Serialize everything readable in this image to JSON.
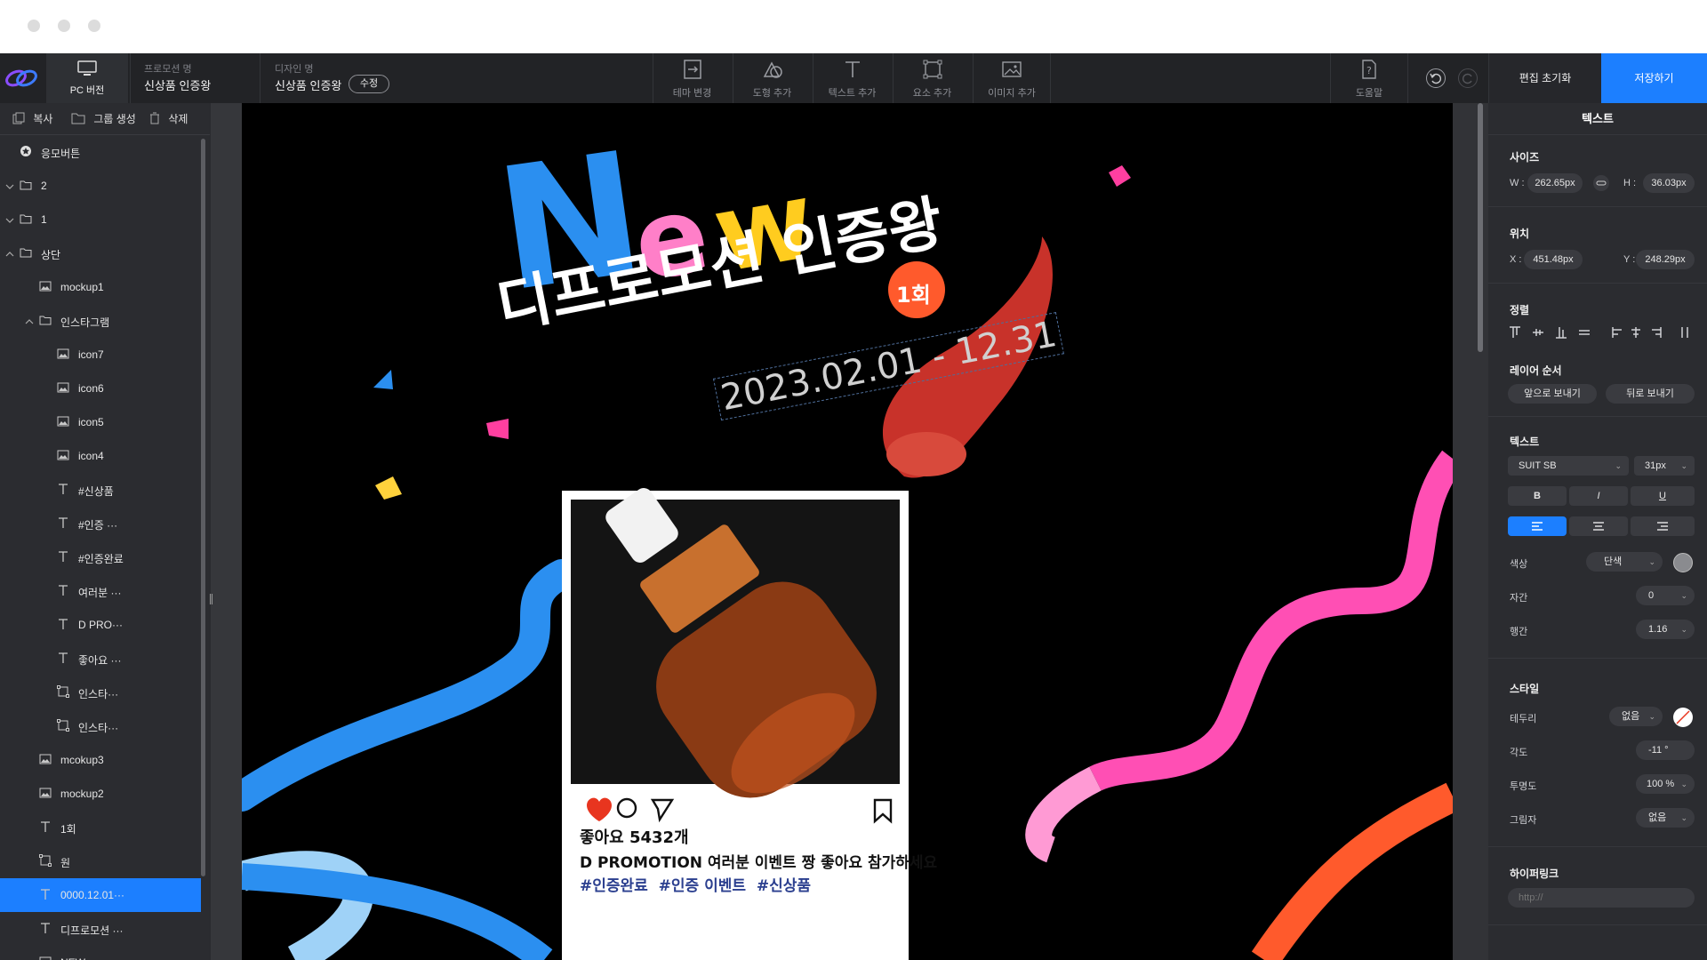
{
  "topbar": {
    "pc_label": "PC 버전",
    "promotion_label": "프로모션 명",
    "promotion_value": "신상품 인증왕",
    "design_label": "디자인 명",
    "design_value": "신상품 인증왕",
    "edit_label": "수정",
    "tools": [
      {
        "label": "테마 변경",
        "icon": "theme-icon"
      },
      {
        "label": "도형 추가",
        "icon": "shape-icon"
      },
      {
        "label": "텍스트 추가",
        "icon": "text-icon"
      },
      {
        "label": "요소 추가",
        "icon": "element-icon"
      },
      {
        "label": "이미지 추가",
        "icon": "image-icon"
      }
    ],
    "help_label": "도움말",
    "reset_label": "편집 초기화",
    "save_label": "저장하기"
  },
  "left": {
    "actions": [
      "복사",
      "그룹 생성",
      "삭제"
    ],
    "layers": [
      {
        "label": "응모버튼",
        "type": "star",
        "indent": 0,
        "chevron": ""
      },
      {
        "label": "2",
        "type": "folder",
        "indent": 0,
        "chevron": "down"
      },
      {
        "label": "1",
        "type": "folder",
        "indent": 0,
        "chevron": "down"
      },
      {
        "label": "상단",
        "type": "folder",
        "indent": 0,
        "chevron": "up"
      },
      {
        "label": "mockup1",
        "type": "image",
        "indent": 1,
        "chevron": ""
      },
      {
        "label": "인스타그램",
        "type": "folder",
        "indent": 1,
        "chevron": "up"
      },
      {
        "label": "icon7",
        "type": "image",
        "indent": 2,
        "chevron": ""
      },
      {
        "label": "icon6",
        "type": "image",
        "indent": 2,
        "chevron": ""
      },
      {
        "label": "icon5",
        "type": "image",
        "indent": 2,
        "chevron": ""
      },
      {
        "label": "icon4",
        "type": "image",
        "indent": 2,
        "chevron": ""
      },
      {
        "label": "#신상품",
        "type": "text",
        "indent": 2,
        "chevron": ""
      },
      {
        "label": "#인증 ···",
        "type": "text",
        "indent": 2,
        "chevron": ""
      },
      {
        "label": "#인증완료",
        "type": "text",
        "indent": 2,
        "chevron": ""
      },
      {
        "label": "여러분 ···",
        "type": "text",
        "indent": 2,
        "chevron": ""
      },
      {
        "label": "D PRO···",
        "type": "text",
        "indent": 2,
        "chevron": ""
      },
      {
        "label": "좋아요 ···",
        "type": "text",
        "indent": 2,
        "chevron": ""
      },
      {
        "label": "인스타···",
        "type": "box",
        "indent": 2,
        "chevron": ""
      },
      {
        "label": "인스타···",
        "type": "box",
        "indent": 2,
        "chevron": ""
      },
      {
        "label": "mcokup3",
        "type": "image",
        "indent": 1,
        "chevron": ""
      },
      {
        "label": "mockup2",
        "type": "image",
        "indent": 1,
        "chevron": ""
      },
      {
        "label": "1회",
        "type": "text",
        "indent": 1,
        "chevron": ""
      },
      {
        "label": "원",
        "type": "box",
        "indent": 1,
        "chevron": ""
      },
      {
        "label": "0000.12.01···",
        "type": "text",
        "indent": 1,
        "chevron": "",
        "selected": true
      },
      {
        "label": "디프로모션 ···",
        "type": "text",
        "indent": 1,
        "chevron": ""
      },
      {
        "label": "NEW",
        "type": "image",
        "indent": 1,
        "chevron": ""
      }
    ]
  },
  "canvas": {
    "new_word": "New",
    "title": "디프로모션 인증왕",
    "date": "2023.02.01 - 12.31",
    "badge": "1회",
    "post": {
      "likes": "좋아요 5432개",
      "caption": "D PROMOTION 여러분 이벤트 짱 좋아요 참가하세요",
      "tags": "#인증완료  #인증 이벤트  #신상품"
    }
  },
  "right": {
    "panel_title": "텍스트",
    "size_title": "사이즈",
    "w_label": "W :",
    "w_value": "262.65px",
    "h_label": "H :",
    "h_value": "36.03px",
    "pos_title": "위치",
    "x_label": "X :",
    "x_value": "451.48px",
    "y_label": "Y :",
    "y_value": "248.29px",
    "align_title": "정렬",
    "order_title": "레이어 순서",
    "front_label": "앞으로 보내기",
    "back_label": "뒤로 보내기",
    "text_title": "텍스트",
    "font": "SUIT SB",
    "font_size": "31px",
    "bold": "B",
    "italic": "I",
    "underline": "U",
    "color_label": "색상",
    "color_mode": "단색",
    "spacing_label": "자간",
    "spacing_value": "0",
    "line_label": "행간",
    "line_value": "1.16",
    "style_title": "스타일",
    "border_label": "테두리",
    "border_value": "없음",
    "angle_label": "각도",
    "angle_value": "-11 °",
    "opacity_label": "투명도",
    "opacity_value": "100 %",
    "shadow_label": "그림자",
    "shadow_value": "없음",
    "link_title": "하이퍼링크",
    "link_placeholder": "http://"
  },
  "colors": {
    "accent": "#1c7fff",
    "panel": "#2b2c30",
    "toolbar": "#222326",
    "heart": "#e8351f",
    "badge": "#ff5a2c"
  }
}
